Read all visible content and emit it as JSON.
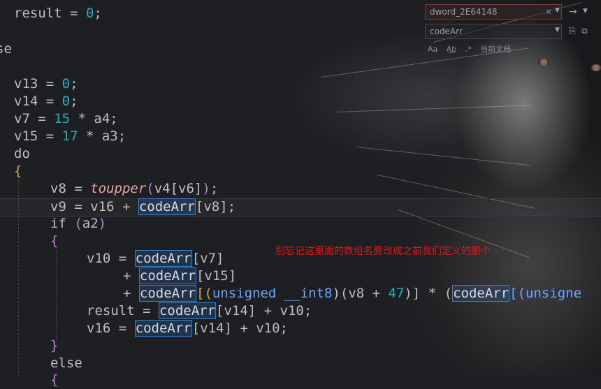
{
  "find_panel": {
    "search_value": "dword_2E64148",
    "replace_value": "codeArr",
    "match_case_label": "Aa",
    "whole_word_label": "A͟b",
    "regex_label": ".*",
    "scope_label": "当前文档",
    "icons": [
      "clear-icon",
      "dropdown-icon",
      "next-icon",
      "replace-next-icon",
      "replace-all-icon"
    ]
  },
  "annotation": "别忘记这里面的数组名要改成之前我们定义的那个",
  "code": {
    "l01": {
      "a": "result = ",
      "b": "0",
      "c": ";"
    },
    "l02": {
      "a": "se"
    },
    "l03": {
      "a": "v13 = ",
      "b": "0",
      "c": ";"
    },
    "l04": {
      "a": "v14 = ",
      "b": "0",
      "c": ";"
    },
    "l05": {
      "a": "v7 = ",
      "b": "15",
      "c": " * a4;"
    },
    "l06": {
      "a": "v15 = ",
      "b": "17",
      "c": " * a3;"
    },
    "l07": {
      "a": "do"
    },
    "l08": {
      "a": "{"
    },
    "l09": {
      "a": "v8 = ",
      "fn": "toupper",
      "p1": "(",
      "b": "v4[v6]",
      "p2": ")",
      "c": ";"
    },
    "l10": {
      "a": "v9 = v16 + ",
      "arr": "codeArr",
      "b": "[v8]",
      "c": ";"
    },
    "l11": {
      "kw": "if",
      "p1": " (",
      "b": "a2",
      "p2": ")"
    },
    "l12": {
      "a": "{"
    },
    "l13": {
      "a": "v10 = ",
      "arr": "codeArr",
      "b": "[v7]"
    },
    "l14": {
      "a": "+ ",
      "arr": "codeArr",
      "b": "[v15]"
    },
    "l15": {
      "a": "+ ",
      "arr": "codeArr",
      "p1": "[(",
      "typ": "unsigned __int8",
      "b": ")(v8 + ",
      "n": "47",
      "c": ")] * (",
      "arr2": "codeArr",
      "d": "[(unsigne"
    },
    "l16": {
      "a": "result = ",
      "arr": "codeArr",
      "b": "[v14] + v10;"
    },
    "l17": {
      "a": "v16 = ",
      "arr": "codeArr",
      "b": "[v14] + v10;"
    },
    "l18": {
      "a": "}"
    },
    "l19": {
      "kw": "else"
    },
    "l20": {
      "a": "{"
    }
  }
}
